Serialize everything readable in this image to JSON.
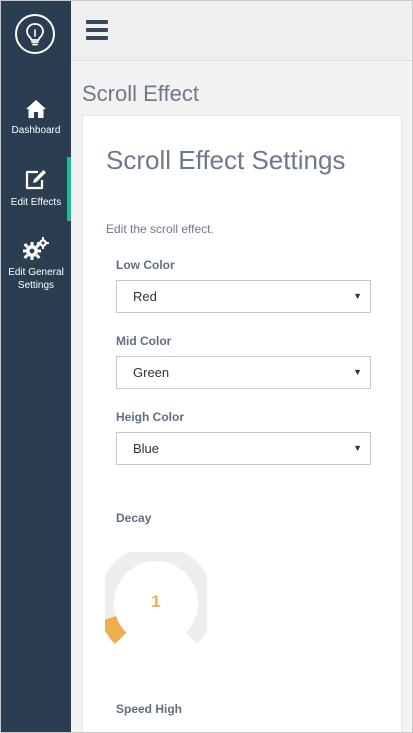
{
  "sidebar": {
    "logo_icon": "lightbulb-icon",
    "items": [
      {
        "icon": "home-icon",
        "label": "Dashboard",
        "active": false
      },
      {
        "icon": "edit-icon",
        "label": "Edit Effects",
        "active": true
      },
      {
        "icon": "cogs-icon",
        "label": "Edit General Settings",
        "active": false
      }
    ],
    "active_color": "#1abc9c",
    "background": "#2b3e51"
  },
  "topbar": {
    "menu_icon": "hamburger-icon"
  },
  "page": {
    "title": "Scroll Effect"
  },
  "card": {
    "title": "Scroll Effect Settings",
    "description": "Edit the scroll effect.",
    "fields": {
      "low_color": {
        "label": "Low Color",
        "value": "Red"
      },
      "mid_color": {
        "label": "Mid Color",
        "value": "Green"
      },
      "high_color": {
        "label": "Heigh Color",
        "value": "Blue"
      },
      "decay": {
        "label": "Decay",
        "value": "1",
        "fraction": 0.1,
        "color": "#f0ad4e"
      },
      "speed_high": {
        "label": "Speed High"
      }
    }
  }
}
